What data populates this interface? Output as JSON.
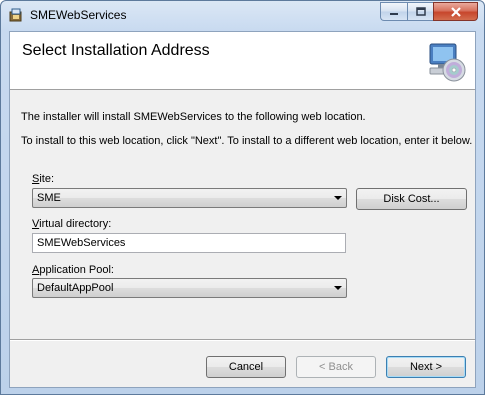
{
  "window": {
    "title": "SMEWebServices",
    "app_icon": "installer-icon"
  },
  "banner": {
    "heading": "Select Installation Address",
    "icon": "computer-cd-icon"
  },
  "body": {
    "line1": "The installer will install SMEWebServices to the following web location.",
    "line2": "To install to this web location, click \"Next\". To install to a different web location, enter it below."
  },
  "form": {
    "site_label_underlined": "S",
    "site_label_rest": "ite:",
    "site_value": "SME",
    "disk_cost_label": "Disk Cost...",
    "vdir_label_underlined": "V",
    "vdir_label_rest": "irtual directory:",
    "vdir_value": "SMEWebServices",
    "pool_label_underlined": "A",
    "pool_label_rest": "pplication Pool:",
    "pool_value": "DefaultAppPool"
  },
  "footer": {
    "cancel_label": "Cancel",
    "back_label": "< Back",
    "next_label": "Next >"
  }
}
